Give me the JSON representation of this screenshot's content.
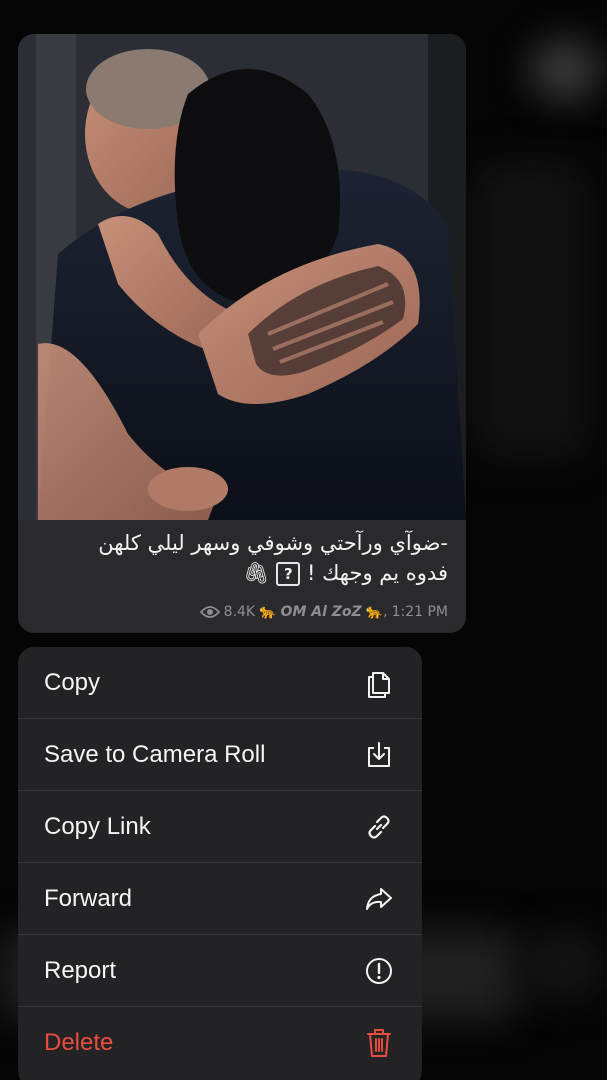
{
  "message": {
    "caption_line1": "-ضوآي ورآحتي وشوفي وسهر ليلي كلهن",
    "caption_line2_text": "فدوه يم وجهك !",
    "caption_qbox": "?",
    "caption_emoji": "🖇",
    "views": "8.4K",
    "author_emoji_left": "🐆",
    "author": "OM Al ZoZ",
    "author_emoji_right": "🐆,",
    "time": "1:21 PM",
    "eye_icon": "eye-icon"
  },
  "menu": {
    "items": [
      {
        "label": "Copy",
        "icon": "copy-icon"
      },
      {
        "label": "Save to Camera Roll",
        "icon": "save-download-icon"
      },
      {
        "label": "Copy Link",
        "icon": "link-icon"
      },
      {
        "label": "Forward",
        "icon": "forward-arrow-icon"
      },
      {
        "label": "Report",
        "icon": "exclamation-circle-icon"
      },
      {
        "label": "Delete",
        "icon": "trash-icon"
      }
    ],
    "danger_color": "#ea4d3d",
    "text_color": "#f5f5f5"
  }
}
